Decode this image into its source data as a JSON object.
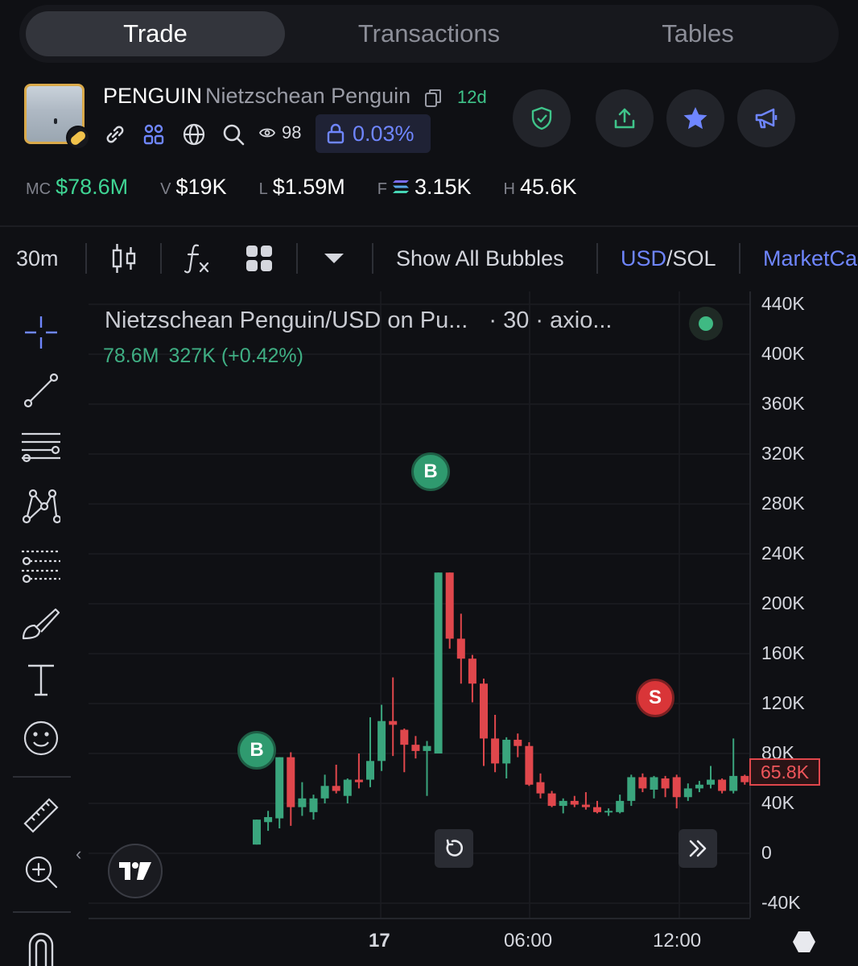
{
  "tabs": [
    {
      "label": "Trade",
      "active": true
    },
    {
      "label": "Transactions",
      "active": false
    },
    {
      "label": "Tables",
      "active": false
    }
  ],
  "token": {
    "symbol": "PENGUIN",
    "name": "Nietzschean Penguin",
    "age": "12d",
    "views": "98",
    "lock_pct": "0.03%"
  },
  "icons": {
    "link": "link-icon",
    "holders": "holders-icon",
    "globe": "globe-icon",
    "search": "search-icon",
    "eye": "eye-icon",
    "lock": "lock-icon",
    "copy": "copy-icon",
    "shield": "shield-check-icon",
    "share": "share-icon",
    "star": "star-icon",
    "megaphone": "megaphone-icon"
  },
  "stats": [
    {
      "key": "MC",
      "value": "$78.6M",
      "accent": true
    },
    {
      "key": "V",
      "value": "$19K",
      "accent": false
    },
    {
      "key": "L",
      "value": "$1.59M",
      "accent": false
    },
    {
      "key": "F",
      "value": "3.15K",
      "accent": false
    },
    {
      "key": "H",
      "value": "45.6K",
      "accent": false
    }
  ],
  "toolbar": {
    "interval": "30m",
    "show_bubbles": "Show All Bubbles",
    "usd": "USD",
    "sol": "/SOL",
    "marketcap": "MarketCa"
  },
  "chart": {
    "title": "Nietzschean Penguin/USD on Pu...",
    "subtitle": "· 30 · axio...",
    "ohlc_value": "78.6M",
    "ohlc_change": "327K (+0.42%)",
    "last_price_tag": "65.8K",
    "y_ticks": [
      "440K",
      "400K",
      "360K",
      "320K",
      "280K",
      "240K",
      "200K",
      "160K",
      "120K",
      "80K",
      "40K",
      "0",
      "-40K"
    ],
    "x_ticks": [
      "17",
      "06:00",
      "12:00"
    ],
    "bubbles": [
      {
        "label": "B",
        "type": "buy"
      },
      {
        "label": "B",
        "type": "buy"
      },
      {
        "label": "S",
        "type": "sell"
      }
    ]
  },
  "colors": {
    "up": "#3aa57d",
    "down": "#e0474c",
    "accent": "#6f86ff",
    "green_text": "#3fd594"
  },
  "chart_data": {
    "type": "candlestick",
    "ylim": [
      -40000,
      440000
    ],
    "y_ticks": [
      440000,
      400000,
      360000,
      320000,
      280000,
      240000,
      200000,
      160000,
      120000,
      80000,
      40000,
      0,
      -40000
    ],
    "candles": [
      {
        "o": 7000,
        "h": 27000,
        "l": 7000,
        "c": 27000
      },
      {
        "o": 25000,
        "h": 34000,
        "l": 18000,
        "c": 29000
      },
      {
        "o": 28000,
        "h": 77000,
        "l": 20000,
        "c": 77000
      },
      {
        "o": 77000,
        "h": 81000,
        "l": 22000,
        "c": 37000
      },
      {
        "o": 37000,
        "h": 57000,
        "l": 30000,
        "c": 44000
      },
      {
        "o": 33000,
        "h": 47000,
        "l": 27000,
        "c": 44000
      },
      {
        "o": 44000,
        "h": 63000,
        "l": 40000,
        "c": 54000
      },
      {
        "o": 54000,
        "h": 71000,
        "l": 48000,
        "c": 50000
      },
      {
        "o": 46000,
        "h": 60000,
        "l": 40000,
        "c": 59000
      },
      {
        "o": 59000,
        "h": 80000,
        "l": 52000,
        "c": 57000
      },
      {
        "o": 59000,
        "h": 109000,
        "l": 53000,
        "c": 74000
      },
      {
        "o": 74000,
        "h": 119000,
        "l": 66000,
        "c": 106000
      },
      {
        "o": 106000,
        "h": 141000,
        "l": 78000,
        "c": 103000
      },
      {
        "o": 99000,
        "h": 100000,
        "l": 65000,
        "c": 87000
      },
      {
        "o": 87000,
        "h": 94000,
        "l": 76000,
        "c": 82000
      },
      {
        "o": 82000,
        "h": 90000,
        "l": 46000,
        "c": 86000
      },
      {
        "o": 80000,
        "h": 225000,
        "l": 80000,
        "c": 225000
      },
      {
        "o": 225000,
        "h": 225000,
        "l": 164000,
        "c": 172000
      },
      {
        "o": 172000,
        "h": 192000,
        "l": 136000,
        "c": 156000
      },
      {
        "o": 156000,
        "h": 159000,
        "l": 121000,
        "c": 136000
      },
      {
        "o": 136000,
        "h": 140000,
        "l": 70000,
        "c": 92000
      },
      {
        "o": 92000,
        "h": 111000,
        "l": 65000,
        "c": 72000
      },
      {
        "o": 72000,
        "h": 93000,
        "l": 60000,
        "c": 91000
      },
      {
        "o": 91000,
        "h": 96000,
        "l": 77000,
        "c": 86000
      },
      {
        "o": 86000,
        "h": 89000,
        "l": 54000,
        "c": 55000
      },
      {
        "o": 57000,
        "h": 64000,
        "l": 44000,
        "c": 48000
      },
      {
        "o": 48000,
        "h": 50000,
        "l": 37000,
        "c": 38000
      },
      {
        "o": 38000,
        "h": 44000,
        "l": 32000,
        "c": 42000
      },
      {
        "o": 42000,
        "h": 46000,
        "l": 37000,
        "c": 39000
      },
      {
        "o": 39000,
        "h": 49000,
        "l": 35000,
        "c": 37000
      },
      {
        "o": 37000,
        "h": 42000,
        "l": 32000,
        "c": 33000
      },
      {
        "o": 33000,
        "h": 36000,
        "l": 30000,
        "c": 34000
      },
      {
        "o": 33000,
        "h": 47000,
        "l": 32000,
        "c": 42000
      },
      {
        "o": 42000,
        "h": 63000,
        "l": 38000,
        "c": 61000
      },
      {
        "o": 61000,
        "h": 64000,
        "l": 49000,
        "c": 52000
      },
      {
        "o": 51000,
        "h": 62000,
        "l": 44000,
        "c": 61000
      },
      {
        "o": 60000,
        "h": 62000,
        "l": 45000,
        "c": 52000
      },
      {
        "o": 61000,
        "h": 63000,
        "l": 36000,
        "c": 45000
      },
      {
        "o": 45000,
        "h": 56000,
        "l": 42000,
        "c": 52000
      },
      {
        "o": 52000,
        "h": 58000,
        "l": 49000,
        "c": 55000
      },
      {
        "o": 55000,
        "h": 70000,
        "l": 52000,
        "c": 59000
      },
      {
        "o": 59000,
        "h": 60000,
        "l": 48000,
        "c": 50000
      },
      {
        "o": 50000,
        "h": 92000,
        "l": 48000,
        "c": 62000
      },
      {
        "o": 62000,
        "h": 63000,
        "l": 55000,
        "c": 57000
      }
    ],
    "bubbles": [
      {
        "label": "B",
        "candle_index": 0,
        "value": 88000
      },
      {
        "label": "B",
        "candle_index": 16,
        "value": 309000
      },
      {
        "label": "S",
        "candle_index": 37,
        "value": 130000
      }
    ],
    "last_price": 65800,
    "x_ticks": [
      "17",
      "06:00",
      "12:00"
    ]
  }
}
